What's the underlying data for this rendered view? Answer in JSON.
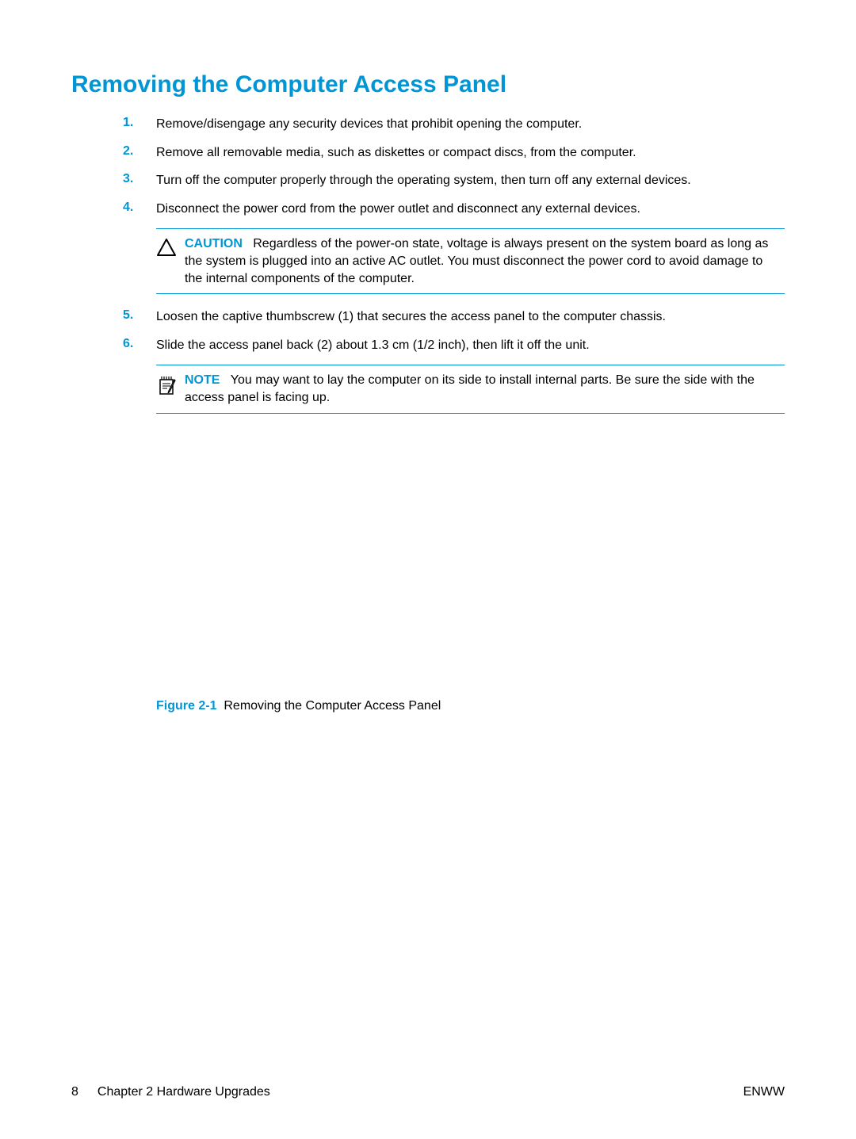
{
  "title": "Removing the Computer Access Panel",
  "steps": [
    {
      "num": "1.",
      "text": "Remove/disengage any security devices that prohibit opening the computer."
    },
    {
      "num": "2.",
      "text": "Remove all removable media, such as diskettes or compact discs, from the computer."
    },
    {
      "num": "3.",
      "text": "Turn off the computer properly through the operating system, then turn off any external devices."
    },
    {
      "num": "4.",
      "text": "Disconnect the power cord from the power outlet and disconnect any external devices."
    }
  ],
  "caution": {
    "label": "CAUTION",
    "text": "Regardless of the power-on state, voltage is always present on the system board as long as the system is plugged into an active AC outlet. You must disconnect the power cord to avoid damage to the internal components of the computer."
  },
  "steps2": [
    {
      "num": "5.",
      "text": "Loosen the captive thumbscrew (1) that secures the access panel to the computer chassis."
    },
    {
      "num": "6.",
      "text": "Slide the access panel back (2) about 1.3 cm (1/2 inch), then lift it off the unit."
    }
  ],
  "note": {
    "label": "NOTE",
    "text": "You may want to lay the computer on its side to install internal parts. Be sure the side with the access panel is facing up."
  },
  "figure": {
    "label": "Figure 2-1",
    "caption": "Removing the Computer Access Panel"
  },
  "footer": {
    "pagenum": "8",
    "chapter": "Chapter 2   Hardware Upgrades",
    "right": "ENWW"
  }
}
